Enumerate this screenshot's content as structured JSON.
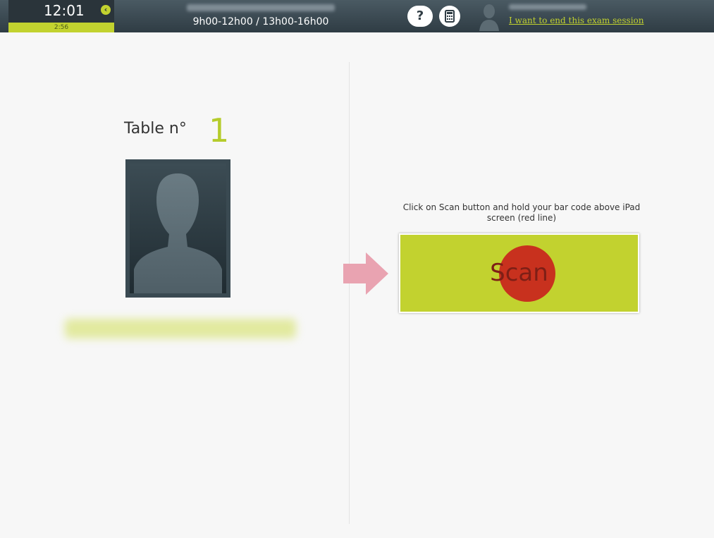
{
  "header": {
    "clock": "12:01",
    "time_remaining": "2:56",
    "session_hours": "9h00-12h00 / 13h00-16h00",
    "help_symbol": "?",
    "end_session_link": "I want to end this exam session",
    "icons": [
      "back-icon",
      "help-icon",
      "calculator-icon",
      "user-silhouette-icon"
    ]
  },
  "candidate": {
    "table_label": "Table n°",
    "table_number": "1"
  },
  "scan": {
    "instruction": "Click on Scan button and hold your bar code above iPad screen (red line)",
    "button_label": "Scan"
  },
  "colors": {
    "accent": "#c2d22f",
    "topbar": "#3a4850",
    "scan_dot": "#c8281e",
    "arrow": "#e9a3b1"
  }
}
